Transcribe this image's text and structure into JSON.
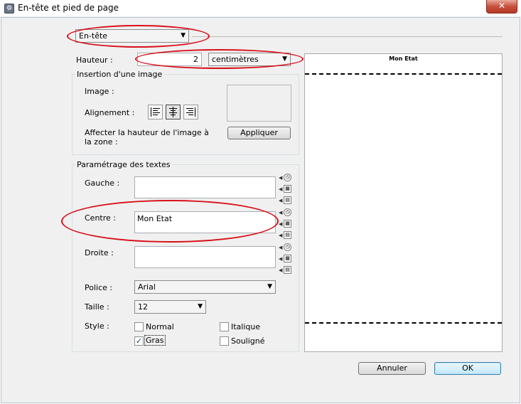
{
  "window": {
    "title": "En-tête et pied de page",
    "icon": "gear-app-icon",
    "close_glyph": "✕"
  },
  "section_select": {
    "value": "En-tête"
  },
  "height": {
    "label": "Hauteur :",
    "value": "2",
    "unit": "centimètres"
  },
  "image_group": {
    "title": "Insertion d'une image",
    "image_label": "Image :",
    "alignment_label": "Alignement :",
    "fit_label": "Affecter la hauteur de l'image à la zone :",
    "apply_button": "Appliquer"
  },
  "text_group": {
    "title": "Paramétrage des textes",
    "left_label": "Gauche :",
    "left_value": "",
    "center_label": "Centre :",
    "center_value": "Mon Etat",
    "right_label": "Droite :",
    "right_value": "",
    "font_label": "Police :",
    "font_value": "Arial",
    "size_label": "Taille :",
    "size_value": "12",
    "style_label": "Style :",
    "styles": {
      "normal": {
        "label": "Normal",
        "checked": false
      },
      "italic": {
        "label": "Italique",
        "checked": false
      },
      "bold": {
        "label": "Gras",
        "checked": true
      },
      "underline": {
        "label": "Souligné",
        "checked": false
      }
    }
  },
  "preview": {
    "header_text": "Mon Etat"
  },
  "buttons": {
    "cancel": "Annuler",
    "ok": "OK"
  },
  "colors": {
    "annotation": "#d8101a",
    "dialog_bg": "#f0f0f0"
  }
}
